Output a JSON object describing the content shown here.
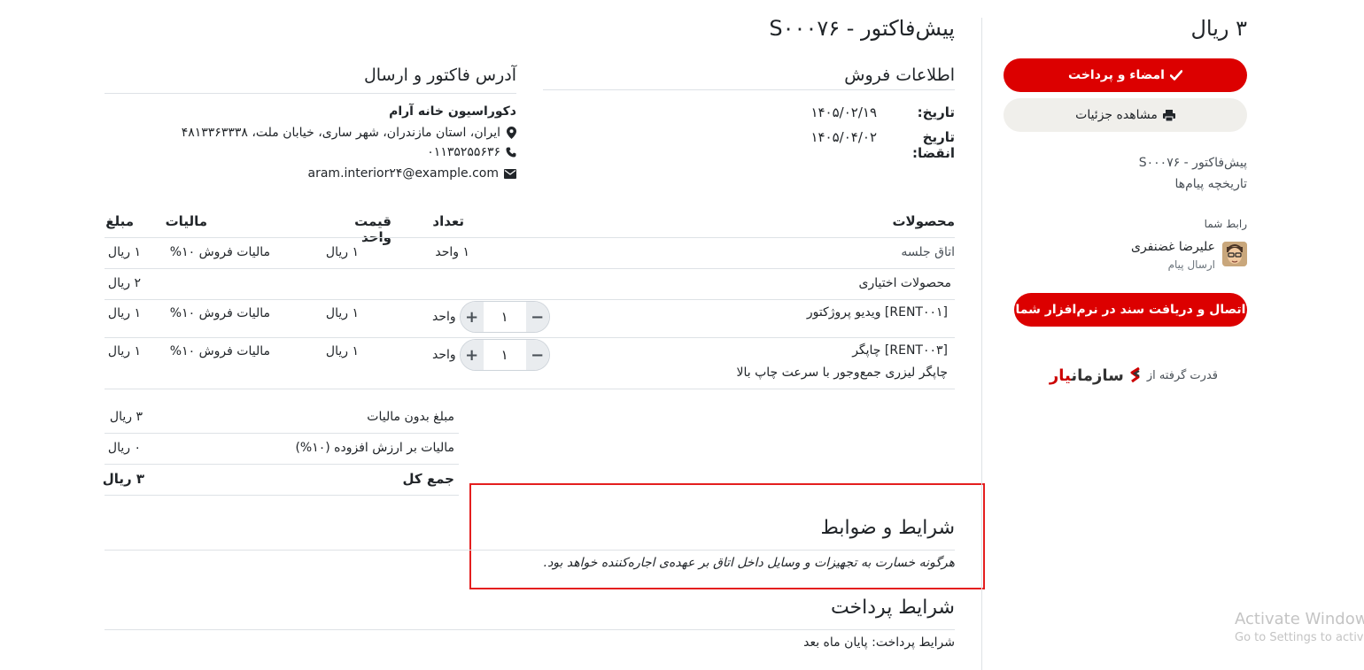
{
  "page": {
    "title": "پیش‌فاکتور - S۰۰۰۷۶"
  },
  "sale_info": {
    "heading": "اطلاعات فروش",
    "date_label": "تاریخ:",
    "date_value": "۱۴۰۵/۰۲/۱۹",
    "expiry_label": "تاریخ انقضا:",
    "expiry_value": "۱۴۰۵/۰۴/۰۲"
  },
  "address": {
    "heading": "آدرس فاکتور و ارسال",
    "company": "دکوراسیون خانه آرام",
    "street": "ایران، استان مازندران، شهر ساری، خیابان ملت، ۴۸۱۳۳۶۳۳۳۸",
    "phone": "۰۱۱۳۵۲۵۵۶۳۶",
    "email": "aram.interior۲۴@example.com"
  },
  "table": {
    "headers": {
      "products": "محصولات",
      "quantity": "تعداد",
      "unit_price": "قیمت واحد",
      "taxes": "مالیات",
      "amount": "مبلغ"
    },
    "rows": [
      {
        "product": "اتاق جلسه",
        "quantity": "۱ واحد",
        "unit_price": "۱ ریال",
        "tax": "مالیات فروش ۱۰%",
        "amount": "۱ ریال"
      }
    ],
    "optional": {
      "label": "محصولات اختیاری",
      "amount": "۲ ریال"
    },
    "optional_rows": [
      {
        "product": "[RENT۰۰۱] ویدیو پروژکتور",
        "description": "",
        "qty_value": "۱",
        "unit": "واحد",
        "unit_price": "۱ ریال",
        "tax": "مالیات فروش ۱۰%",
        "amount": "۱ ریال"
      },
      {
        "product": "[RENT۰۰۳] چاپگر",
        "description": "چاپگر لیزری جمع‌وجور با سرعت چاپ بالا",
        "qty_value": "۱",
        "unit": "واحد",
        "unit_price": "۱ ریال",
        "tax": "مالیات فروش ۱۰%",
        "amount": "۱ ریال"
      }
    ]
  },
  "totals": {
    "untaxed_label": "مبلغ بدون مالیات",
    "untaxed_value": "۳ ریال",
    "vat_label": "مالیات بر ارزش افزوده (۱۰%)",
    "vat_value": "۰ ریال",
    "total_label": "جمع کل",
    "total_value": "۳ ریال"
  },
  "terms": {
    "heading": "شرایط و ضوابط",
    "text": "هرگونه خسارت به تجهیزات و وسایل داخل اتاق بر عهده‌ی اجاره‌کننده خواهد بود."
  },
  "payment_terms": {
    "heading": "شرایط پرداخت",
    "text": "شرایط پرداخت: پایان ماه بعد"
  },
  "sidebar": {
    "amount": "۳ ریال",
    "sign_pay_label": "امضاء و پرداخت",
    "view_details_label": "مشاهده جزئیات",
    "doc_link": "پیش‌فاکتور - S۰۰۰۷۶",
    "history_link": "تاریخچه پیام‌ها",
    "contact_label": "رابط شما",
    "contact_name": "علیرضا غضنفری",
    "send_message": "ارسال پیام",
    "connect_label": "اتصال و دریافت سند در نرم‌افزار شما",
    "powered_by": "قدرت گرفته از",
    "brand_part1": "سازمان",
    "brand_part2": "یار"
  },
  "windows_watermark": {
    "line1": "Activate Windows",
    "line2": "Go to Settings to activate Windows."
  },
  "colors": {
    "accent": "#dc0000",
    "highlight_border": "#e41e1e",
    "divider": "#dee2e6"
  },
  "icons": {
    "sign": "check-icon",
    "details": "printer-icon",
    "address": "map-marker-icon",
    "phone": "phone-icon",
    "email": "envelope-icon"
  }
}
